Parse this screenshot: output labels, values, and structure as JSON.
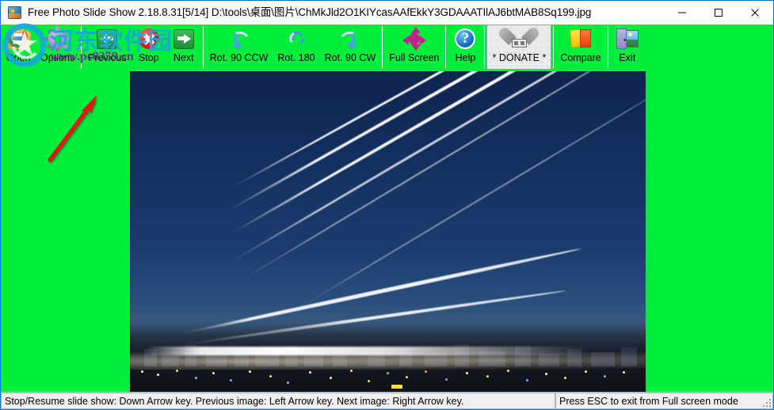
{
  "window": {
    "title": "Free Photo Slide Show 2.18.8.31[5/14] D:\\tools\\桌面\\图片\\ChMkJld2O1KIYcasAAfEkkY3GDAAATIlAJ6btMAB8Sq199.jpg",
    "app_icon": "slideshow-icon",
    "accent_color": "#0078d7",
    "background_color": "#00ef3c",
    "controls": {
      "minimize_label": "—",
      "maximize_label": "□",
      "close_label": "✕"
    }
  },
  "toolbar": {
    "buttons": [
      {
        "label": "Open",
        "icon": "open-folder-icon",
        "hovered": false
      },
      {
        "label": "Options",
        "icon": "gear-icon",
        "hovered": false
      },
      {
        "label": "Previous",
        "icon": "previous-arrow-icon",
        "hovered": false
      },
      {
        "label": "Stop",
        "icon": "stop-icon",
        "hovered": false
      },
      {
        "label": "Next",
        "icon": "next-arrow-icon",
        "hovered": false
      },
      {
        "label": "Rot. 90 CCW",
        "icon": "rotate-ccw-icon",
        "hovered": false
      },
      {
        "label": "Rot. 180",
        "icon": "rotate-180-icon",
        "hovered": false
      },
      {
        "label": "Rot. 90 CW",
        "icon": "rotate-cw-icon",
        "hovered": false
      },
      {
        "label": "Full Screen",
        "icon": "fullscreen-arrows-icon",
        "hovered": false
      },
      {
        "label": "Help",
        "icon": "help-question-icon",
        "hovered": false
      },
      {
        "label": "* DONATE *",
        "icon": "donate-heart-icon",
        "hovered": true
      },
      {
        "label": "Compare",
        "icon": "compare-cards-icon",
        "hovered": false
      },
      {
        "label": "Exit",
        "icon": "exit-door-icon",
        "hovered": false
      }
    ]
  },
  "viewer": {
    "photo_description": "night long-exposure airport photo with aircraft light trails over city skyline",
    "sky_color": "#13305f",
    "annotation": {
      "type": "red-arrow",
      "color": "#e01b1b",
      "points_to": "Options"
    }
  },
  "statusbar": {
    "left_text": "Stop/Resume slide show: Down Arrow key. Previous image: Left Arrow key. Next image: Right Arrow key.",
    "right_text": "Press ESC to exit from Full screen mode"
  },
  "watermark": {
    "text": "河东软件园",
    "url": "www.pc0359.cn",
    "text_color": "#18a7e0",
    "url_color": "#7d1fa8"
  }
}
